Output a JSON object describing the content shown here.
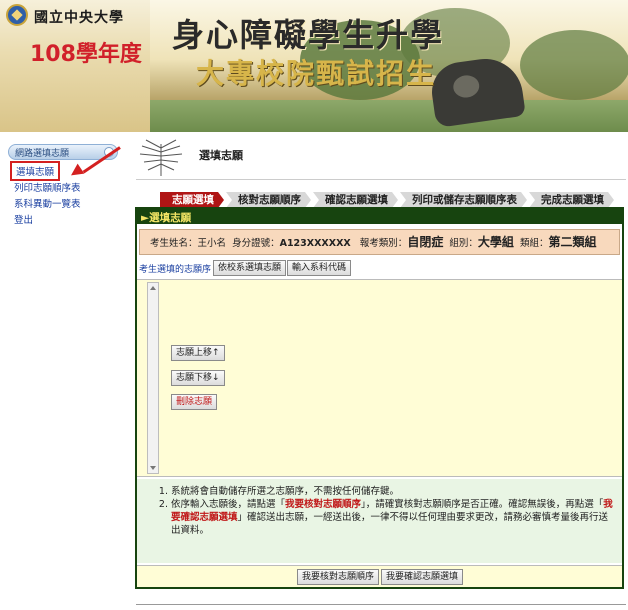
{
  "banner": {
    "university": "國立中央大學",
    "year": "108學年度",
    "title_line1": "身心障礙學生升學",
    "title_line2": "大專校院甄試招生"
  },
  "sidebar": {
    "header": "網路選填志願",
    "items": [
      {
        "label": "選填志願"
      },
      {
        "label": "列印志願順序表"
      },
      {
        "label": "系科異動一覽表"
      },
      {
        "label": "登出"
      }
    ]
  },
  "page": {
    "title": "選填志願"
  },
  "steps": [
    "志願選填",
    "核對志願順序",
    "確認志願選填",
    "列印或儲存志願順序表",
    "完成志願選填"
  ],
  "panel": {
    "header": "►選填志願",
    "info": {
      "name_label": "考生姓名：",
      "name": "王小名",
      "id_label": "身分證號：",
      "id": "A123XXXXXX",
      "category_label": "報考類別：",
      "category": "自閉症",
      "group_label": "組別：",
      "group": "大學組",
      "subgroup_label": "類組：",
      "subgroup": "第二類組"
    },
    "tabs_label": "考生選填的志願序",
    "tab_buttons": [
      "依校系選填志願",
      "輸入系科代碼"
    ],
    "list_buttons": {
      "move_up": "志願上移↑",
      "move_down": "志願下移↓",
      "delete": "刪除志願"
    },
    "notes": {
      "note1": "系統將會自動儲存所選之志願序，不需按任何儲存鍵。",
      "note2_a": "依序輸入志願後，請點選「",
      "note2_hl1": "我要核對志願順序",
      "note2_b": "」，請確實核對志願順序是否正確。確認無誤後，再點選「",
      "note2_hl2": "我要確認志願選填",
      "note2_c": "」確認送出志願，一經送出後，一律不得以任何理由要求更改，請務必審慎考量後再行送出資料。"
    },
    "footer_buttons": {
      "check": "我要核對志願順序",
      "confirm": "我要確認志願選填"
    }
  },
  "colors": {
    "panel_dark_green": "#17440f",
    "panel_header_text": "#f3e565",
    "step_active": "#b01515",
    "info_bar": "#f8d9bd",
    "list_area": "#fffdd6",
    "notes_bg": "#e9f5e4",
    "year_red": "#d1202a",
    "highlight_red": "#d42020"
  }
}
